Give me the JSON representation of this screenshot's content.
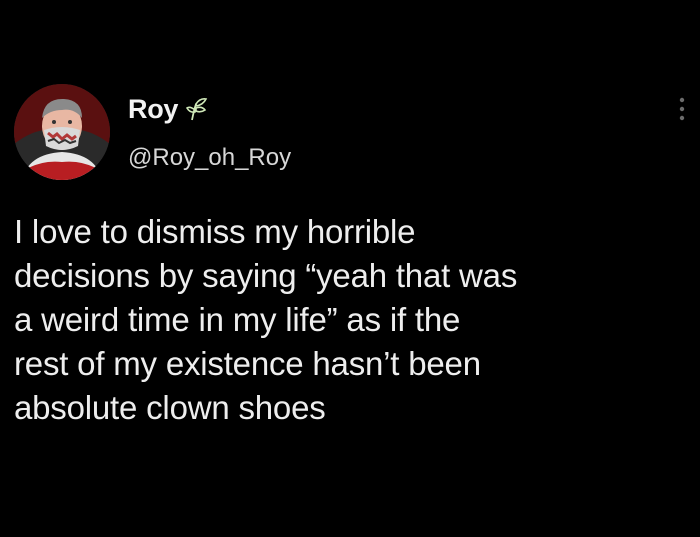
{
  "author": {
    "display_name": "Roy",
    "handle": "@Roy_oh_Roy",
    "badge_icon": "plant-sprout-icon",
    "avatar": "profile-photo"
  },
  "menu": {
    "icon": "more-vertical-icon"
  },
  "tweet": {
    "text": "I love to dismiss my horrible\ndecisions by saying “yeah that was\na weird time in my life” as if the\nrest of my existence hasn’t been\nabsolute clown shoes"
  },
  "colors": {
    "background": "#000000",
    "text": "#eeeeee",
    "secondary_text": "#d7d7d7",
    "badge": "#cfe8b8"
  }
}
